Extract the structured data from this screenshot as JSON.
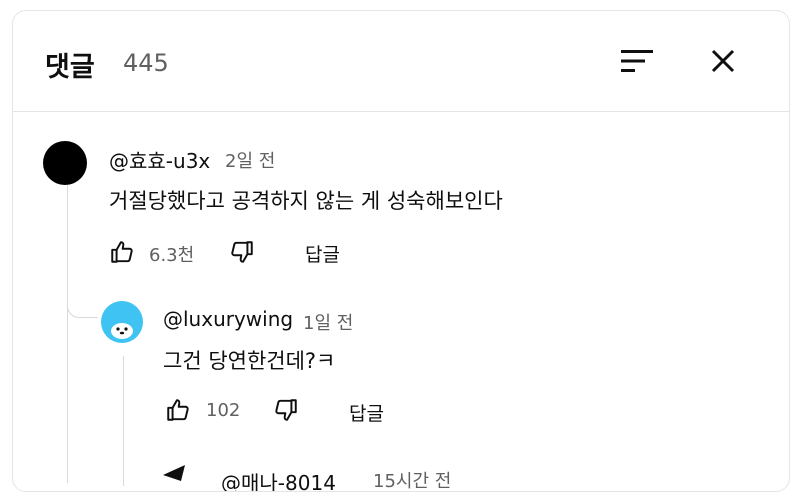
{
  "header": {
    "title": "댓글",
    "count": "445"
  },
  "icons": {
    "sort": "sort-icon",
    "close": "close-icon",
    "like": "thumbs-up-icon",
    "dislike": "thumbs-down-icon"
  },
  "comments": [
    {
      "author": "@효효-u3x",
      "time": "2일 전",
      "text": "거절당했다고 공격하지 않는 게 성숙해보인다",
      "likes": "6.3천",
      "reply_label": "답글"
    }
  ],
  "replies": [
    {
      "author": "@luxurywing",
      "time": "1일 전",
      "text": "그건 당연한건데?ㅋ",
      "likes": "102",
      "reply_label": "답글"
    },
    {
      "author": "@매나-8014",
      "time": "15시간 전"
    }
  ],
  "colors": {
    "text": "#0f0f0f",
    "muted": "#606060",
    "divider": "#e5e5e5",
    "avatar_blue": "#3ec3f2"
  }
}
